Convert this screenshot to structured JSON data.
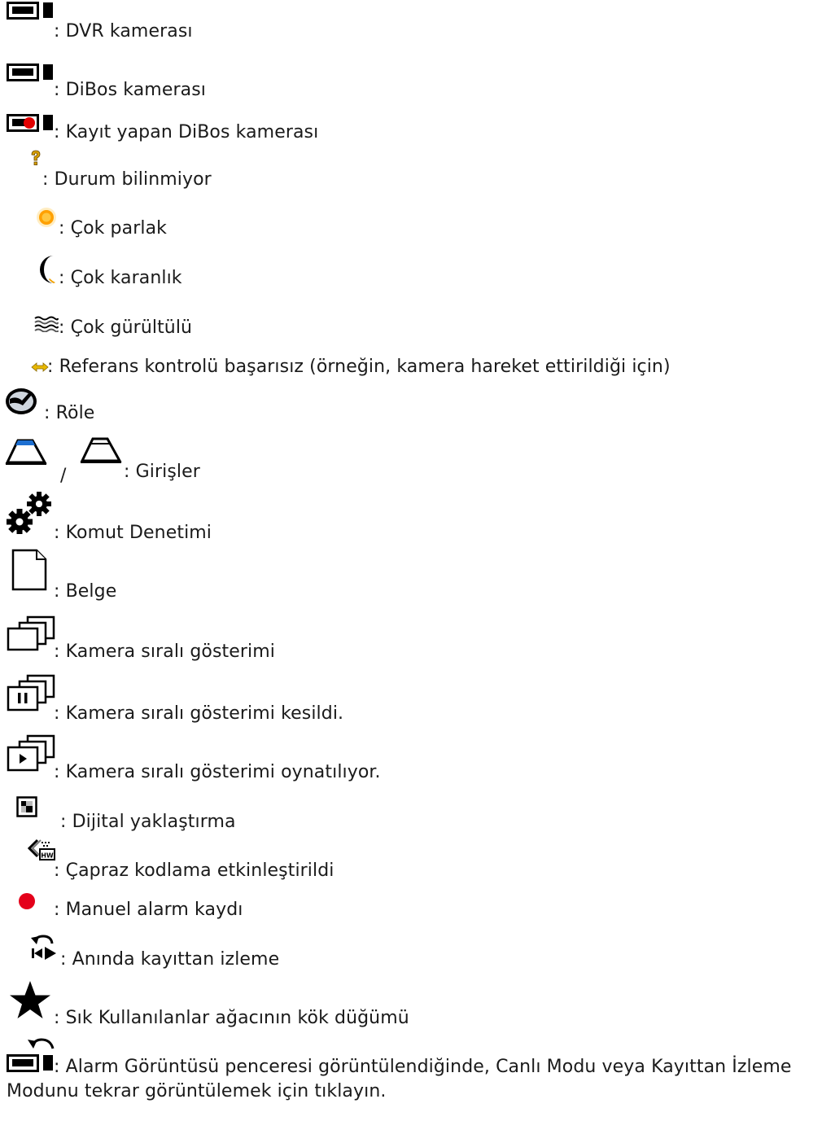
{
  "legend": [
    {
      "icon": "dvr-camera-icon",
      "label": ": DVR kamerası"
    },
    {
      "icon": "dibos-camera-icon",
      "label": ": DiBos kamerası"
    },
    {
      "icon": "dibos-recording-camera-icon",
      "label": ": Kayıt yapan DiBos kamerası"
    },
    {
      "icon": "unknown-status-icon",
      "label": ": Durum bilinmiyor"
    },
    {
      "icon": "too-bright-icon",
      "label": ": Çok parlak"
    },
    {
      "icon": "too-dark-icon",
      "label": ": Çok karanlık"
    },
    {
      "icon": "too-noisy-icon",
      "label": ": Çok gürültülü"
    },
    {
      "icon": "reference-check-failed-icon",
      "label": ": Referans kontrolü başarısız (örneğin, kamera hareket ettirildiği için)"
    },
    {
      "icon": "relay-icon",
      "label": ": Röle"
    },
    {
      "icon": "input-icons",
      "label": ": Girişler",
      "separator": "/"
    },
    {
      "icon": "command-script-icon",
      "label": ": Komut Denetimi"
    },
    {
      "icon": "document-icon",
      "label": ": Belge"
    },
    {
      "icon": "camera-sequence-icon",
      "label": ": Kamera sıralı gösterimi"
    },
    {
      "icon": "camera-sequence-paused-icon",
      "label": ": Kamera sıralı gösterimi kesildi."
    },
    {
      "icon": "camera-sequence-playing-icon",
      "label": ": Kamera sıralı gösterimi oynatılıyor."
    },
    {
      "icon": "digital-zoom-icon",
      "label": ": Dijital yaklaştırma"
    },
    {
      "icon": "transcoding-icon",
      "label": ": Çapraz kodlama etkinleştirildi"
    },
    {
      "icon": "manual-alarm-recording-icon",
      "label": ": Manuel alarm kaydı"
    },
    {
      "icon": "instant-playback-icon",
      "label": ": Anında kayıttan izleme"
    },
    {
      "icon": "favorites-root-icon",
      "label": ": Sık Kullanılanlar ağacının kök düğümü"
    },
    {
      "icon": "alarm-return-icon",
      "label": ": Alarm Görüntüsü penceresi görüntülendiğinde, Canlı Modu veya Kayıttan İzleme Modunu tekrar görüntülemek için tıklayın."
    }
  ]
}
